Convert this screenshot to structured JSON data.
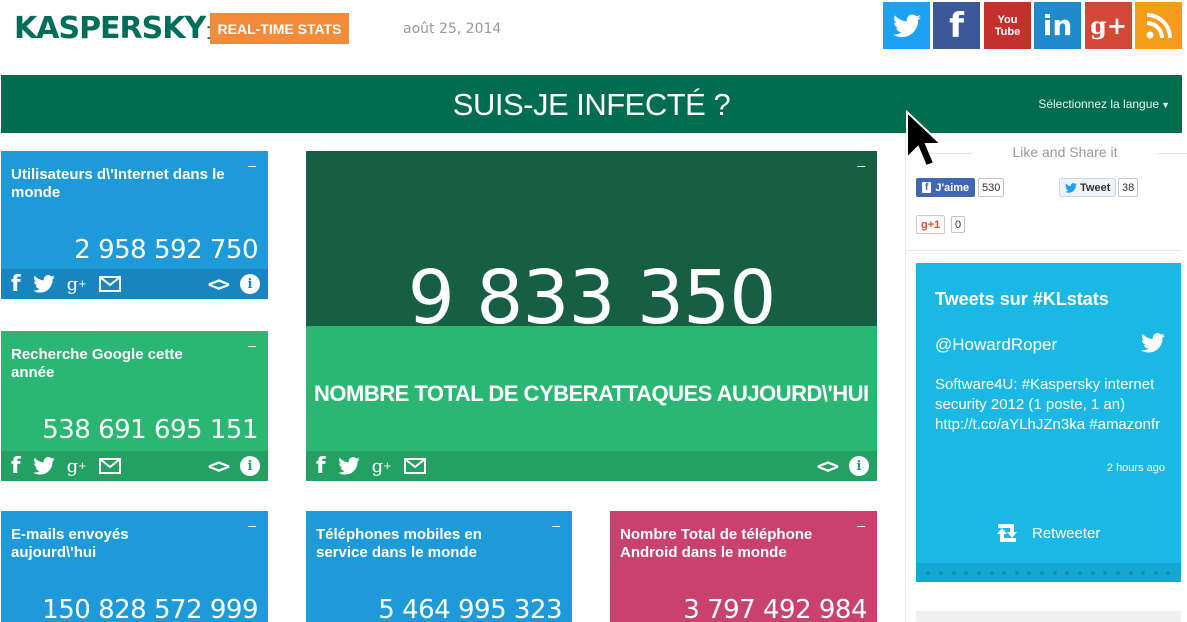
{
  "header": {
    "logo_text": "KASPERSKY",
    "logo_lab": "lab",
    "realtime_button": "REAL-TIME STATS",
    "date": "août 25, 2014"
  },
  "social": [
    {
      "name": "twitter-icon"
    },
    {
      "name": "facebook-icon",
      "glyph": "f"
    },
    {
      "name": "youtube-icon",
      "line1": "You",
      "line2": "Tube"
    },
    {
      "name": "linkedin-icon",
      "glyph": "in"
    },
    {
      "name": "googleplus-icon",
      "glyph": "g+"
    },
    {
      "name": "rss-icon"
    }
  ],
  "titlebar": {
    "title": "SUIS-JE INFECTÉ ?",
    "language": "Sélectionnez la langue"
  },
  "tiles": {
    "internet_users": {
      "title": "Utilisateurs d\\'Internet dans le monde",
      "value": "2 958 592 750"
    },
    "google_searches": {
      "title": "Recherche Google cette année",
      "value": "538 691 695 151"
    },
    "emails": {
      "title": "E-mails envoyés aujourd\\'hui",
      "value": "150 828 572 999"
    },
    "cyberattacks": {
      "value": "9 833 350",
      "label": "NOMBRE TOTAL DE CYBERATTAQUES AUJOURD\\'HUI"
    },
    "mobile_phones": {
      "title": "Téléphones mobiles en service dans le monde",
      "value": "5 464 995 323"
    },
    "android_phones": {
      "title": "Nombre Total de téléphone Android dans le monde",
      "value": "3 797 492 984"
    }
  },
  "tile_minimize": "–",
  "share_labels": {
    "facebook": "f",
    "googleplus": "g",
    "plus": "+",
    "info": "i",
    "code": "<>"
  },
  "sidebar": {
    "like_share": "Like and Share it",
    "fb_like": "J'aime",
    "fb_count": "530",
    "tweet": "Tweet",
    "tweet_count": "38",
    "gplus": "g+1",
    "gplus_count": "0"
  },
  "twitter_widget": {
    "heading": "Tweets sur #KLstats",
    "user": "@HowardRoper",
    "text": "Software4U: #Kaspersky internet security 2012 (1 poste, 1 an) http://t.co/aYLhJZn3ka #amazonfr",
    "time": "2 hours ago",
    "retweet": "Retweeter"
  },
  "colors": {
    "brand_green": "#006d4e",
    "tile_blue": "#1f9ad8",
    "tile_green": "#2bb673",
    "tile_pink": "#c9416e",
    "big_tile_dark": "#175f44",
    "realtime_orange": "#f28c3b",
    "twitter_widget": "#1bb8e6"
  }
}
